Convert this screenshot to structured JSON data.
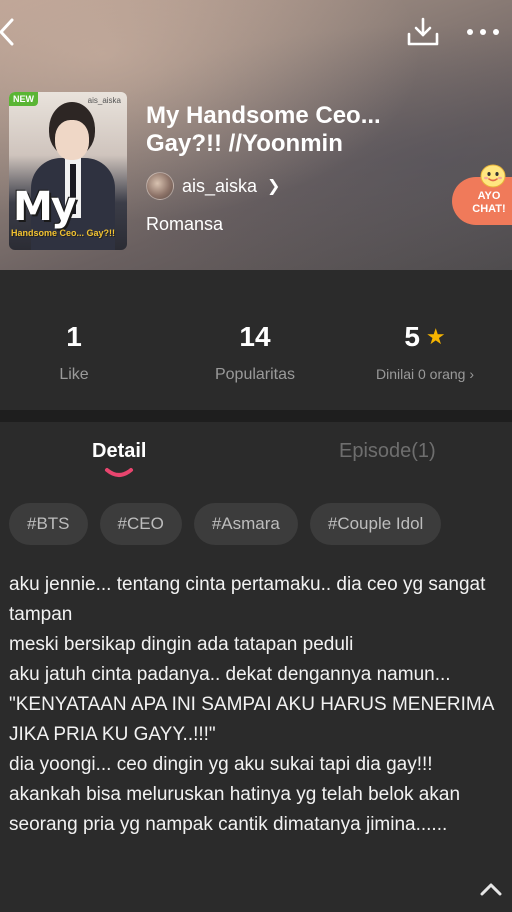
{
  "header": {
    "cover": {
      "badge": "NEW",
      "watermark": "ais_aiska",
      "logo_title": "My",
      "logo_subtitle": "Handsome Ceo... Gay?!!"
    },
    "title": "My Handsome Ceo... Gay?!! //Yoonmin",
    "author": "ais_aiska",
    "genre": "Romansa",
    "chat_button": {
      "line1": "AYO",
      "line2": "CHAT!"
    },
    "icons": [
      "back-icon",
      "download-icon",
      "more-icon"
    ]
  },
  "stats": {
    "like": {
      "value": "1",
      "label": "Like"
    },
    "popularity": {
      "value": "14",
      "label": "Popularitas"
    },
    "rating": {
      "value": "5",
      "label": "Dinilai 0 orang"
    }
  },
  "tabs": [
    {
      "label": "Detail",
      "active": true
    },
    {
      "label": "Episode(1)",
      "active": false
    }
  ],
  "tags": [
    "#BTS",
    "#CEO",
    "#Asmara",
    "#Couple Idol"
  ],
  "description": "aku jennie... tentang cinta pertamaku.. dia ceo yg sangat tampan\nmeski bersikap dingin ada tatapan peduli\naku jatuh cinta padanya.. dekat dengannya namun...\n\"KENYATAAN APA INI SAMPAI AKU HARUS MENERIMA JIKA PRIA KU GAYY..!!!\"\ndia yoongi... ceo dingin yg aku sukai tapi dia gay!!!\nakankah bisa meluruskan hatinya yg telah belok akan seorang pria yg nampak cantik dimatanya jimina......",
  "colors": {
    "accent": "#e8456e",
    "star": "#f5b400",
    "chat_button": "#f07a5a",
    "badge_new": "#5ab534"
  }
}
